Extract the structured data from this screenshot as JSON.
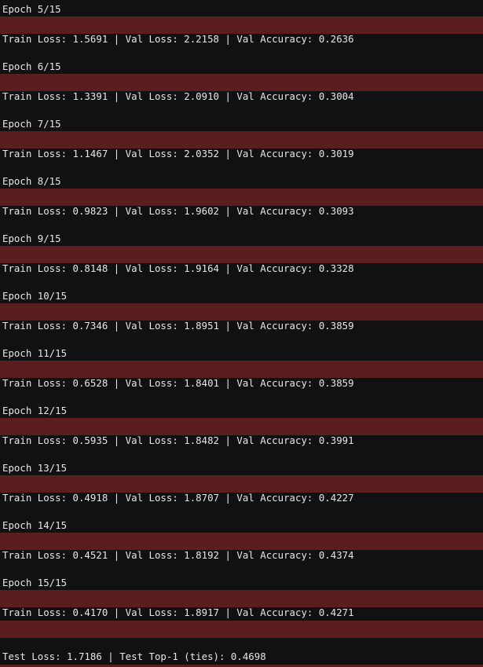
{
  "colors": {
    "background": "#111113",
    "stderr_bar": "#5a1e1e",
    "text": "#e6e6e6"
  },
  "log": {
    "epochs": [
      {
        "header": "Epoch 5/15",
        "metrics": "Train Loss: 1.5691 | Val Loss: 2.2158 | Val Accuracy: 0.2636"
      },
      {
        "header": "Epoch 6/15",
        "metrics": "Train Loss: 1.3391 | Val Loss: 2.0910 | Val Accuracy: 0.3004"
      },
      {
        "header": "Epoch 7/15",
        "metrics": "Train Loss: 1.1467 | Val Loss: 2.0352 | Val Accuracy: 0.3019"
      },
      {
        "header": "Epoch 8/15",
        "metrics": "Train Loss: 0.9823 | Val Loss: 1.9602 | Val Accuracy: 0.3093"
      },
      {
        "header": "Epoch 9/15",
        "metrics": "Train Loss: 0.8148 | Val Loss: 1.9164 | Val Accuracy: 0.3328"
      },
      {
        "header": "Epoch 10/15",
        "metrics": "Train Loss: 0.7346 | Val Loss: 1.8951 | Val Accuracy: 0.3859"
      },
      {
        "header": "Epoch 11/15",
        "metrics": "Train Loss: 0.6528 | Val Loss: 1.8401 | Val Accuracy: 0.3859"
      },
      {
        "header": "Epoch 12/15",
        "metrics": "Train Loss: 0.5935 | Val Loss: 1.8482 | Val Accuracy: 0.3991"
      },
      {
        "header": "Epoch 13/15",
        "metrics": "Train Loss: 0.4918 | Val Loss: 1.8707 | Val Accuracy: 0.4227"
      },
      {
        "header": "Epoch 14/15",
        "metrics": "Train Loss: 0.4521 | Val Loss: 1.8192 | Val Accuracy: 0.4374"
      },
      {
        "header": "Epoch 15/15",
        "metrics": "Train Loss: 0.4170 | Val Loss: 1.8917 | Val Accuracy: 0.4271"
      }
    ],
    "test_result": "Test Loss: 1.7186 | Test Top-1 (ties): 0.4698"
  }
}
